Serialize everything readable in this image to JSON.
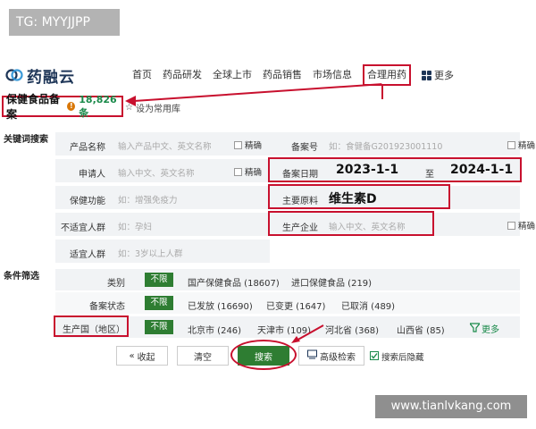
{
  "watermark_tag": "TG: MYYJJPP",
  "watermark_site": "www.tianlvkang.com",
  "header": {
    "logo_text": "药融云",
    "nav": [
      "首页",
      "药品研发",
      "全球上市",
      "药品销售",
      "市场信息",
      "合理用药"
    ],
    "active_nav": "合理用药",
    "more_label": "更多"
  },
  "page": {
    "title": "保健食品备案",
    "count": "18,826条",
    "fav_label": "设为常用库"
  },
  "search": {
    "section_label": "关键词搜索",
    "exact_label": "精确",
    "fields": {
      "product_name": {
        "label": "产品名称",
        "placeholder": "输入产品中文、英文名称"
      },
      "record_no": {
        "label": "备案号",
        "placeholder": "如：食健备G201923001110"
      },
      "applicant": {
        "label": "申请人",
        "placeholder": "输入中文、英文名称"
      },
      "record_date": {
        "label": "备案日期",
        "from": "2023-1-1",
        "to_label": "至",
        "to": "2024-1-1"
      },
      "health_function": {
        "label": "保健功能",
        "placeholder": "如：增强免疫力"
      },
      "main_material": {
        "label": "主要原料",
        "value": "维生素D"
      },
      "unsuitable": {
        "label": "不适宜人群",
        "placeholder": "如：孕妇"
      },
      "manufacturer": {
        "label": "生产企业",
        "placeholder": "输入中文、英文名称"
      },
      "suitable": {
        "label": "适宜人群",
        "placeholder": "如：3岁以上人群"
      }
    }
  },
  "filters": {
    "section_label": "条件筛选",
    "no_limit": "不限",
    "category": {
      "label": "类别",
      "options": [
        "国产保健食品 (18607)",
        "进口保健食品 (219)"
      ]
    },
    "status": {
      "label": "备案状态",
      "options": [
        "已发放 (16690)",
        "已变更 (1647)",
        "已取消 (489)"
      ]
    },
    "region": {
      "label": "生产国（地区）",
      "options": [
        "北京市 (246)",
        "天津市 (109)",
        "河北省 (368)",
        "山西省 (85)"
      ]
    },
    "more_label": "更多"
  },
  "buttons": {
    "collapse": "收起",
    "clear": "清空",
    "search": "搜索",
    "advanced": "高级检索",
    "hide_after_search": "搜索后隐藏"
  },
  "colors": {
    "accent_red": "#c8102e",
    "brand_green": "#2e7d32",
    "count_green": "#1a8a4a"
  }
}
